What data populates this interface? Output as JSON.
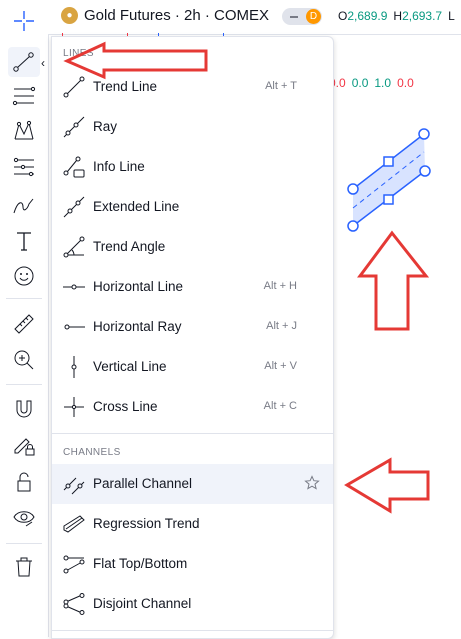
{
  "header": {
    "symbol_icon_text": "🪙",
    "symbol_title": "Gold Futures · 2h · COMEX",
    "session_badge": "D",
    "ohlc": [
      {
        "k": "O",
        "v": "2,689.9"
      },
      {
        "k": "H",
        "v": "2,693.7"
      },
      {
        "k": "L",
        "v": ""
      }
    ]
  },
  "chart": {
    "values_row": [
      {
        "text": "0.0",
        "color": "#f23645"
      },
      {
        "text": "0.0",
        "color": "#089981"
      },
      {
        "text": "1.0",
        "color": "#089981"
      },
      {
        "text": "0.0",
        "color": "#f23645"
      }
    ]
  },
  "toolbar": {
    "icons": [
      "crosshair-icon",
      "trend-line-tool-icon",
      "fib-tool-icon",
      "pattern-tool-icon",
      "prediction-tool-icon",
      "brush-tool-icon",
      "text-tool-icon",
      "emoji-icon",
      "ruler-icon",
      "zoom-in-icon",
      "magnet-icon",
      "lock-pencil-icon",
      "lock-icon",
      "eye-icon",
      "trash-icon"
    ],
    "collapse": "‹"
  },
  "menu": {
    "sections": [
      {
        "title": "LINES",
        "items": [
          {
            "label": "Trend Line",
            "shortcut": "Alt + T",
            "icon": "trend-line-icon"
          },
          {
            "label": "Ray",
            "shortcut": "",
            "icon": "ray-icon"
          },
          {
            "label": "Info Line",
            "shortcut": "",
            "icon": "info-line-icon"
          },
          {
            "label": "Extended Line",
            "shortcut": "",
            "icon": "extended-line-icon"
          },
          {
            "label": "Trend Angle",
            "shortcut": "",
            "icon": "trend-angle-icon"
          },
          {
            "label": "Horizontal Line",
            "shortcut": "Alt + H",
            "icon": "horizontal-line-icon"
          },
          {
            "label": "Horizontal Ray",
            "shortcut": "Alt + J",
            "icon": "horizontal-ray-icon"
          },
          {
            "label": "Vertical Line",
            "shortcut": "Alt + V",
            "icon": "vertical-line-icon"
          },
          {
            "label": "Cross Line",
            "shortcut": "Alt + C",
            "icon": "cross-line-icon"
          }
        ]
      },
      {
        "title": "CHANNELS",
        "items": [
          {
            "label": "Parallel Channel",
            "shortcut": "",
            "icon": "parallel-channel-icon"
          },
          {
            "label": "Regression Trend",
            "shortcut": "",
            "icon": "regression-trend-icon"
          },
          {
            "label": "Flat Top/Bottom",
            "shortcut": "",
            "icon": "flat-top-bottom-icon"
          },
          {
            "label": "Disjoint Channel",
            "shortcut": "",
            "icon": "disjoint-channel-icon"
          }
        ]
      }
    ],
    "highlighted": "Parallel Channel"
  },
  "colors": {
    "accent": "#2962ff",
    "annotation_red": "#e53935",
    "up": "#089981",
    "down": "#f23645"
  }
}
